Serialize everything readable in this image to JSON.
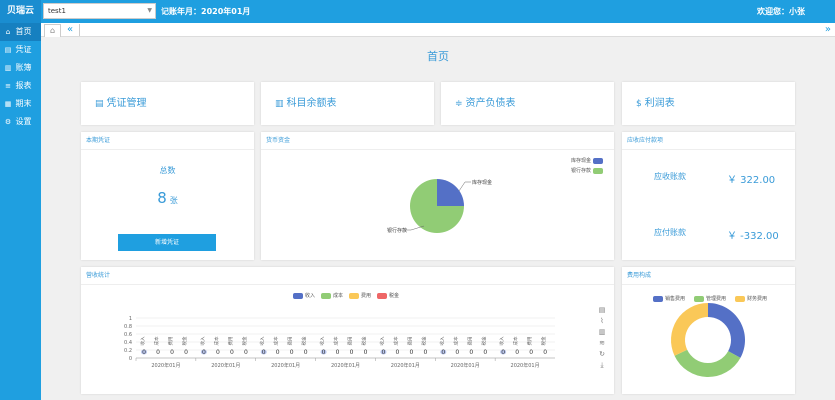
{
  "app": {
    "brand": "贝瑞云"
  },
  "header": {
    "account_selected": "test1",
    "period_label": "记账年月：",
    "period_value": "2020年01月",
    "welcome": "欢迎您：小张"
  },
  "sidebar": {
    "items": [
      {
        "label": "首页",
        "icon": "home-icon"
      },
      {
        "label": "凭证",
        "icon": "document-icon"
      },
      {
        "label": "账簿",
        "icon": "book-icon"
      },
      {
        "label": "报表",
        "icon": "report-icon"
      },
      {
        "label": "期末",
        "icon": "calendar-icon"
      },
      {
        "label": "设置",
        "icon": "gear-icon"
      }
    ]
  },
  "page": {
    "title": "首页"
  },
  "quick_links": [
    {
      "label": "凭证管理",
      "icon": "file-icon"
    },
    {
      "label": "科目余额表",
      "icon": "bank-icon"
    },
    {
      "label": "资产负债表",
      "icon": "sliders-icon"
    },
    {
      "label": "利润表",
      "icon": "dollar-icon"
    }
  ],
  "vouchers_card": {
    "title": "本期凭证",
    "count_label": "总数",
    "count": "8",
    "count_unit": "张",
    "button_label": "新增凭证"
  },
  "funds_card": {
    "title": "货币资金"
  },
  "ar_ap_card": {
    "title": "应收应付款项",
    "receivable_label": "应收账款",
    "receivable_value": "￥ 322.00",
    "payable_label": "应付账款",
    "payable_value": "￥ -332.00"
  },
  "income_card": {
    "title": "营收统计"
  },
  "expense_card": {
    "title": "费用构成"
  },
  "colors": {
    "blue": "#5470c6",
    "green": "#91cc75",
    "yellow": "#fac858",
    "red": "#ee6666",
    "accent": "#1f9fe0"
  },
  "chart_data": [
    {
      "type": "pie",
      "categories": [
        "库存现金",
        "银行存款"
      ],
      "values": [
        25,
        75
      ]
    },
    {
      "type": "bar",
      "series_names": [
        "收入",
        "成本",
        "费用",
        "税金"
      ],
      "ylim": [
        0,
        1
      ],
      "yticks": [
        "0",
        "0.2",
        "0.4",
        "0.6",
        "0.8",
        "1"
      ],
      "categories": [
        "2020年01月",
        "2020年01月",
        "2020年01月",
        "2020年01月",
        "2020年01月",
        "2020年01月",
        "2020年01月"
      ],
      "group_labels": [
        "收入",
        "成本",
        "费用",
        "税金"
      ],
      "bar_value_label": "0"
    },
    {
      "type": "pie",
      "categories": [
        "销售费用",
        "管理费用",
        "财务费用"
      ],
      "values": [
        33,
        35,
        32
      ]
    }
  ]
}
